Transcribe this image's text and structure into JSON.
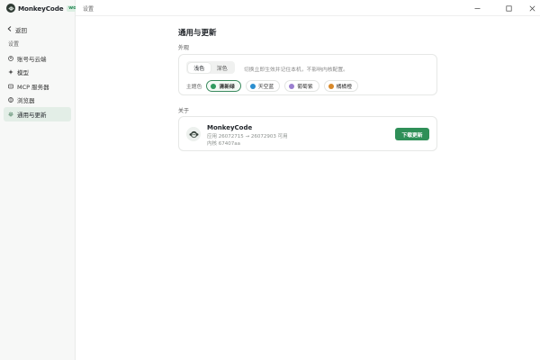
{
  "brand": {
    "name": "MonkeyCode",
    "badge": "work"
  },
  "sidebar": {
    "back_label": "返回",
    "section_label": "设置",
    "items": [
      {
        "label": "账号与云端",
        "icon": "user-circle-icon"
      },
      {
        "label": "模型",
        "icon": "sparkle-icon"
      },
      {
        "label": "MCP 服务器",
        "icon": "server-icon"
      },
      {
        "label": "浏览器",
        "icon": "globe-icon"
      },
      {
        "label": "通用与更新",
        "icon": "gear-icon",
        "active": true
      }
    ]
  },
  "titlebar": {
    "title": "设置"
  },
  "main": {
    "page_title": "通用与更新",
    "appearance": {
      "label": "外观",
      "modes": [
        "浅色",
        "深色"
      ],
      "selected_mode": "浅色",
      "hint": "切换立即生效并记住本机，不影响内核配置。",
      "theme_label": "主题色",
      "themes": [
        {
          "label": "清新绿",
          "color": "#2f9a5f",
          "active": true
        },
        {
          "label": "天空蓝",
          "color": "#2b8fd0"
        },
        {
          "label": "葡萄紫",
          "color": "#9b7fd0"
        },
        {
          "label": "橘橘橙",
          "color": "#d8892b"
        }
      ]
    },
    "about": {
      "label": "关于",
      "app_name": "MonkeyCode",
      "version_line": "应用  26072715  →  26072903  可用",
      "kernel_line": "内核  67407aa",
      "update_button": "下载更新"
    }
  },
  "colors": {
    "accent": "#2f8f58",
    "sidebar_bg": "#f7f8f7",
    "active_nav_bg": "#e3eee7"
  }
}
